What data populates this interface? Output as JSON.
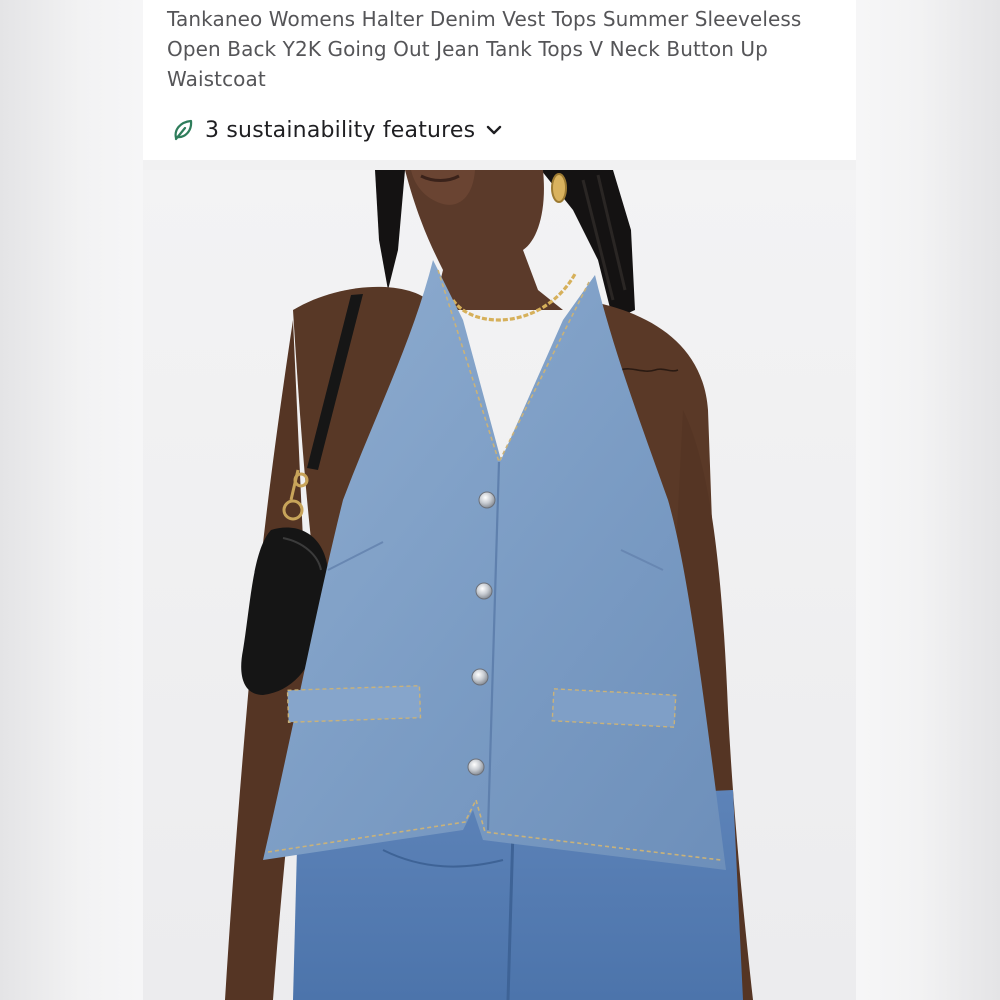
{
  "product": {
    "title": "Tankaneo Womens Halter Denim Vest Tops Summer Sleeveless Open Back Y2K Going Out Jean Tank Tops V Neck Button Up Waistcoat"
  },
  "sustainability": {
    "label": "3 sustainability features",
    "icon": "leaf-icon",
    "expand_icon": "chevron-down-icon",
    "accent_color": "#2e7d5b"
  },
  "photo": {
    "alt": "Model wearing light-wash denim halter vest with silver buttons and front welt pockets"
  },
  "colors": {
    "background": "#f1f1f2",
    "card": "#ffffff",
    "denim": "#7fa0c6",
    "title_text": "#555558"
  }
}
